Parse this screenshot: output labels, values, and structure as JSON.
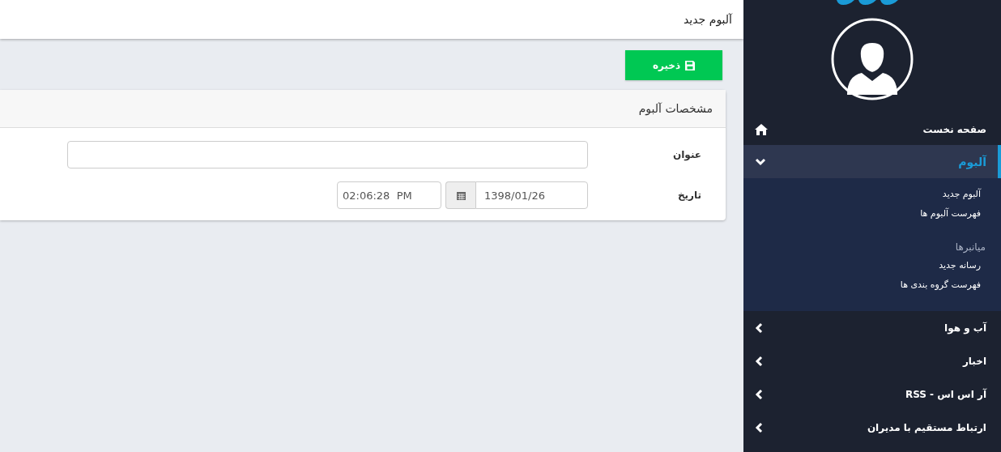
{
  "header": {
    "title": "آلبوم جدید"
  },
  "toolbar": {
    "save_button": "ذخیره"
  },
  "card": {
    "title": "مشخصات آلبوم",
    "fields": [
      {
        "kind": "text",
        "label": "عنوان"
      },
      {
        "kind": "datetime",
        "label": "تاریخ",
        "date": "1398/01/26",
        "time": "02:06:28  PM"
      }
    ]
  },
  "sidebar": {
    "items": [
      {
        "label": "صفحه نخست",
        "kind": "home",
        "selected": false
      },
      {
        "label": "آلبوم",
        "kind": "group",
        "selected": true,
        "expanded": true,
        "children": [
          {
            "kind": "link",
            "label": "آلبوم جدید"
          },
          {
            "kind": "link",
            "label": "فهرست آلبوم ها"
          },
          {
            "kind": "heading",
            "label": "میانبرها"
          },
          {
            "kind": "link",
            "label": "رسانه جدید"
          },
          {
            "kind": "link",
            "label": "فهرست گروه بندی ها"
          }
        ]
      },
      {
        "label": "آب و هوا",
        "kind": "group",
        "selected": false,
        "expanded": false
      },
      {
        "label": "اخبار",
        "kind": "group",
        "selected": false,
        "expanded": false
      },
      {
        "label": "آر اس اس - RSS",
        "kind": "group",
        "selected": false,
        "expanded": false
      },
      {
        "label": "ارتباط مستقیم با مدیران",
        "kind": "group",
        "selected": false,
        "expanded": false
      }
    ]
  }
}
